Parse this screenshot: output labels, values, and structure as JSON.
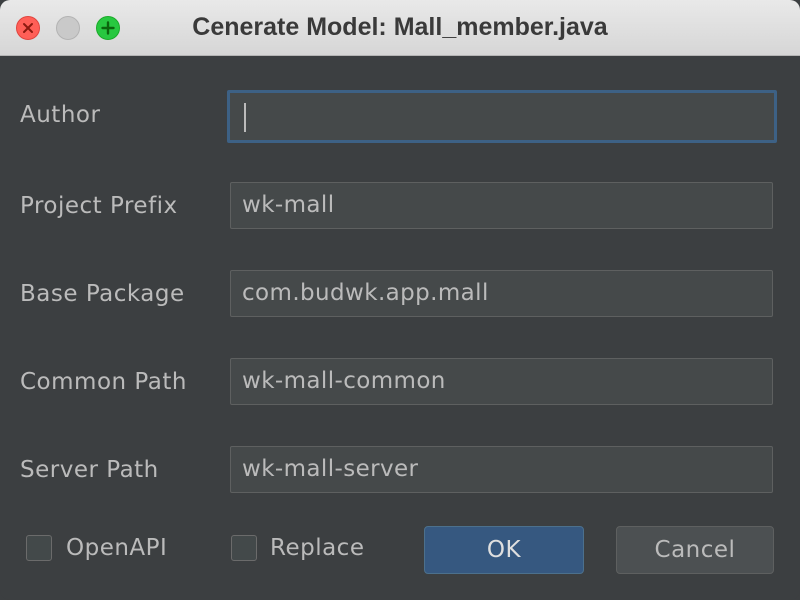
{
  "window": {
    "title": "Cenerate Model: Mall_member.java"
  },
  "form": {
    "author": {
      "label": "Author",
      "value": ""
    },
    "project_prefix": {
      "label": "Project Prefix",
      "value": "wk-mall"
    },
    "base_package": {
      "label": "Base Package",
      "value": "com.budwk.app.mall"
    },
    "common_path": {
      "label": "Common Path",
      "value": "wk-mall-common"
    },
    "server_path": {
      "label": "Server Path",
      "value": "wk-mall-server"
    }
  },
  "options": {
    "openapi": {
      "label": "OpenAPI",
      "checked": false
    },
    "replace": {
      "label": "Replace",
      "checked": false
    }
  },
  "buttons": {
    "ok": "OK",
    "cancel": "Cancel"
  },
  "colors": {
    "dialog_background": "#3c3f41",
    "field_background": "#45494a",
    "focus_border": "#3d6185",
    "primary_button": "#365880",
    "text": "#bbbbbb"
  },
  "icons": {
    "close": "close-icon",
    "minimize": "minimize-icon",
    "maximize": "plus-icon"
  }
}
